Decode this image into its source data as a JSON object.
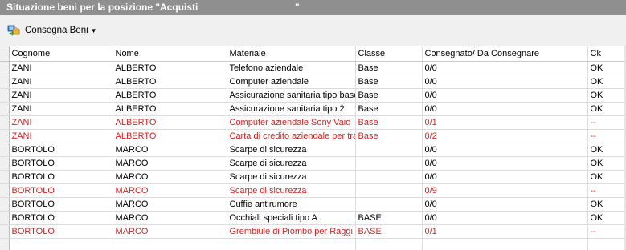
{
  "window": {
    "title": "Situazione beni per la posizione \"Acquisti",
    "title_end": "\""
  },
  "toolbar": {
    "consegna_label": "Consegna Beni"
  },
  "grid": {
    "columns": [
      "Cognome",
      "Nome",
      "Materiale",
      "Classe",
      "Consegnato/ Da Consegnare",
      "Ck"
    ],
    "rows": [
      {
        "cognome": "ZANI",
        "nome": "ALBERTO",
        "materiale": "Telefono aziendale",
        "classe": "Base",
        "consegnato": "0/0",
        "ck": "OK",
        "alert": false
      },
      {
        "cognome": "ZANI",
        "nome": "ALBERTO",
        "materiale": "Computer aziendale",
        "classe": "Base",
        "consegnato": "0/0",
        "ck": "OK",
        "alert": false
      },
      {
        "cognome": "ZANI",
        "nome": "ALBERTO",
        "materiale": "Assicurazione sanitaria tipo base",
        "classe": "Base",
        "consegnato": "0/0",
        "ck": "OK",
        "alert": false
      },
      {
        "cognome": "ZANI",
        "nome": "ALBERTO",
        "materiale": "Assicurazione sanitaria tipo 2",
        "classe": "Base",
        "consegnato": "0/0",
        "ck": "OK",
        "alert": false
      },
      {
        "cognome": "ZANI",
        "nome": "ALBERTO",
        "materiale": "Computer aziendale  Sony Vaio",
        "classe": "Base",
        "consegnato": "0/1",
        "ck": "--",
        "alert": true
      },
      {
        "cognome": "ZANI",
        "nome": "ALBERTO",
        "materiale": "Carta di credito aziendale per trasferte",
        "classe": "Base",
        "consegnato": "0/2",
        "ck": "--",
        "alert": true
      },
      {
        "cognome": "BORTOLO",
        "nome": "MARCO",
        "materiale": "Scarpe di sicurezza",
        "classe": "",
        "consegnato": "0/0",
        "ck": "OK",
        "alert": false
      },
      {
        "cognome": "BORTOLO",
        "nome": "MARCO",
        "materiale": "Scarpe di sicurezza",
        "classe": "",
        "consegnato": "0/0",
        "ck": "OK",
        "alert": false
      },
      {
        "cognome": "BORTOLO",
        "nome": "MARCO",
        "materiale": "Scarpe di sicurezza",
        "classe": "",
        "consegnato": "0/0",
        "ck": "OK",
        "alert": false
      },
      {
        "cognome": "BORTOLO",
        "nome": "MARCO",
        "materiale": "Scarpe di sicurezza",
        "classe": "",
        "consegnato": "0/9",
        "ck": "--",
        "alert": true
      },
      {
        "cognome": "BORTOLO",
        "nome": "MARCO",
        "materiale": "Cuffie antirumore",
        "classe": "",
        "consegnato": "0/0",
        "ck": "OK",
        "alert": false
      },
      {
        "cognome": "BORTOLO",
        "nome": "MARCO",
        "materiale": "Occhiali speciali tipo A",
        "classe": "BASE",
        "consegnato": "0/0",
        "ck": "OK",
        "alert": false
      },
      {
        "cognome": "BORTOLO",
        "nome": "MARCO",
        "materiale": "Grembiule di Piombo per Raggi x",
        "classe": "BASE",
        "consegnato": "0/1",
        "ck": "--",
        "alert": true
      },
      {
        "cognome": "",
        "nome": "",
        "materiale": "",
        "classe": "",
        "consegnato": "",
        "ck": "",
        "alert": false
      }
    ]
  },
  "colors": {
    "title_bg": "#8f8f8f",
    "alert_text": "#e01e1e",
    "toolbar_bg": "#f0f0f0"
  }
}
